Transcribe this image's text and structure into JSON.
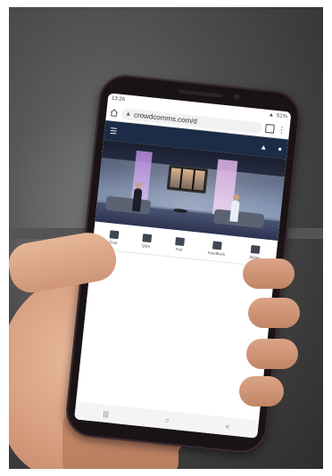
{
  "status_bar": {
    "time": "13:26",
    "battery": "51%"
  },
  "browser": {
    "url": "crowdcomms.com/d"
  },
  "nav": {
    "recents": "|||",
    "home": "○",
    "back": "<"
  },
  "tools": [
    {
      "label": "Chat",
      "icon": "chat-icon"
    },
    {
      "label": "Q&A",
      "icon": "qa-icon"
    },
    {
      "label": "Poll",
      "icon": "poll-icon"
    },
    {
      "label": "Feedback",
      "icon": "feedback-icon"
    },
    {
      "label": "Slides",
      "icon": "slides-icon"
    }
  ],
  "colors": {
    "header": "#1c2c46",
    "phone_body": "#1a1316"
  }
}
